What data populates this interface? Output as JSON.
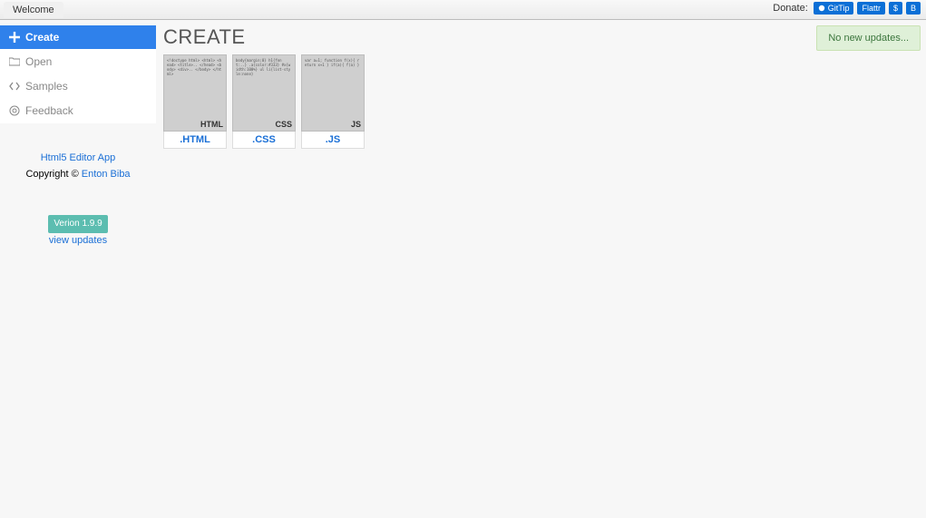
{
  "tabbar": {
    "active_tab": "Welcome",
    "donate_label": "Donate:",
    "badges": [
      {
        "id": "gittip",
        "label": "GitTip"
      },
      {
        "id": "flattr",
        "label": "Flattr"
      },
      {
        "id": "dollar",
        "label": "$"
      },
      {
        "id": "bitcoin",
        "label": "B"
      }
    ]
  },
  "sidebar": {
    "items": [
      {
        "id": "create",
        "label": "Create",
        "icon": "plus-icon",
        "active": true
      },
      {
        "id": "open",
        "label": "Open",
        "icon": "folder-icon",
        "active": false
      },
      {
        "id": "samples",
        "label": "Samples",
        "icon": "code-icon",
        "active": false
      },
      {
        "id": "feedback",
        "label": "Feedback",
        "icon": "at-icon",
        "active": false
      }
    ],
    "app_name": "Html5 Editor App",
    "copyright_prefix": "Copyright © ",
    "author": "Enton Biba",
    "version_label": "Verion 1.9.9",
    "view_updates": "view updates"
  },
  "main": {
    "title": "CREATE",
    "notice": "No new updates...",
    "tiles": [
      {
        "tag": "HTML",
        "label": ".HTML"
      },
      {
        "tag": "CSS",
        "label": ".CSS"
      },
      {
        "tag": "JS",
        "label": ".JS"
      }
    ]
  }
}
